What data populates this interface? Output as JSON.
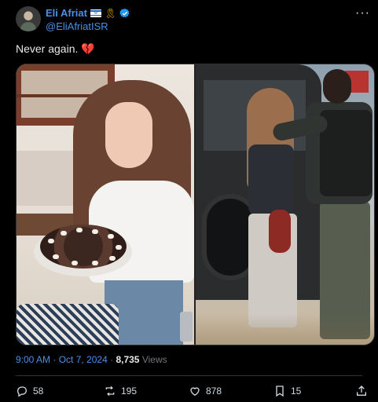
{
  "author": {
    "display_name": "Eli Afriat",
    "handle": "@EliAfriatISR",
    "flag": "🇮🇱",
    "ribbon": "🎗",
    "verified": true
  },
  "tweet": {
    "text": "Never again.",
    "emoji": "💔"
  },
  "meta": {
    "time": "9:00 AM",
    "separator": "·",
    "date": "Oct 7, 2024",
    "views_count": "8,735",
    "views_label": "Views"
  },
  "actions": {
    "replies": "58",
    "reposts": "195",
    "likes": "878",
    "bookmarks": "15"
  },
  "icons": {
    "more": "more-icon",
    "reply": "reply-icon",
    "repost": "repost-icon",
    "like": "like-icon",
    "bookmark": "bookmark-icon",
    "share": "share-icon"
  },
  "colors": {
    "background": "#000000",
    "link": "#4c8fe6",
    "muted": "#71767b",
    "verified": "#1d9bf0"
  }
}
